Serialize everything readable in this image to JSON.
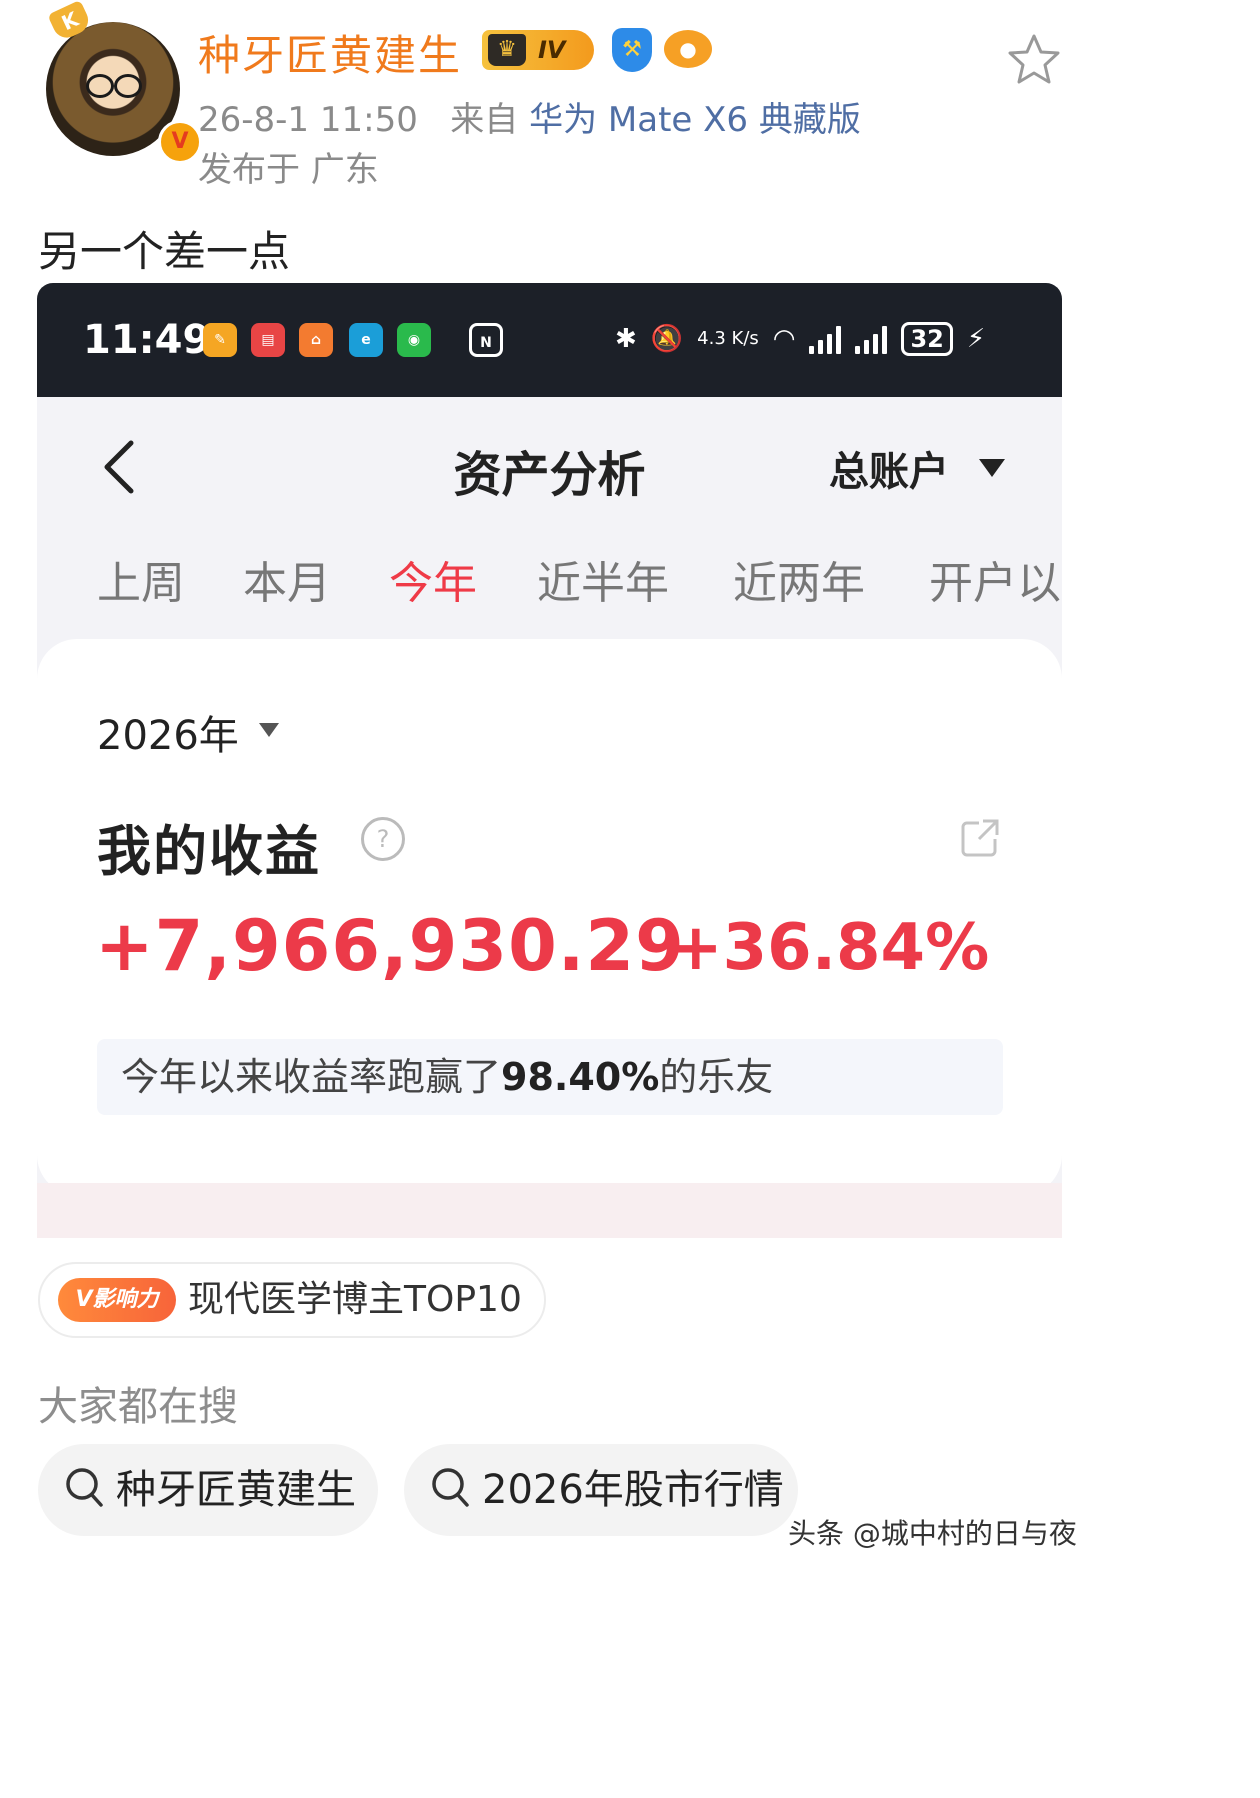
{
  "post": {
    "author": "种牙匠黄建生",
    "level_badge": "IV",
    "time": "26-8-1 11:50",
    "source_prefix": "来自",
    "device": "华为 Mate X6 典藏版",
    "location": "发布于 广东",
    "text": "另一个差一点"
  },
  "screenshot": {
    "status_bar": {
      "time": "11:49",
      "net_speed": "4.3 K/s",
      "battery": "32"
    },
    "nav": {
      "title": "资产分析",
      "account": "总账户"
    },
    "tabs": [
      "上周",
      "本月",
      "今年",
      "近半年",
      "近两年",
      "开户以"
    ],
    "active_tab": "今年",
    "card": {
      "year": "2026年",
      "title": "我的收益",
      "amount": "+7,966,930.29",
      "percent": "+36.84%",
      "beat_prefix": "今年以来收益率跑赢了",
      "beat_value": "98.40%",
      "beat_suffix": "的乐友"
    }
  },
  "influence": {
    "tag": "V影响力",
    "text": "现代医学博主TOP10"
  },
  "search": {
    "title": "大家都在搜",
    "chips": [
      "种牙匠黄建生",
      "2026年股市行情"
    ]
  },
  "watermark": "头条 @城中村的日与夜",
  "colors": {
    "author": "#f07a1c",
    "accent_red": "#ec3a49",
    "link": "#4f6ea4",
    "statusbar_bg": "#1c2028"
  }
}
